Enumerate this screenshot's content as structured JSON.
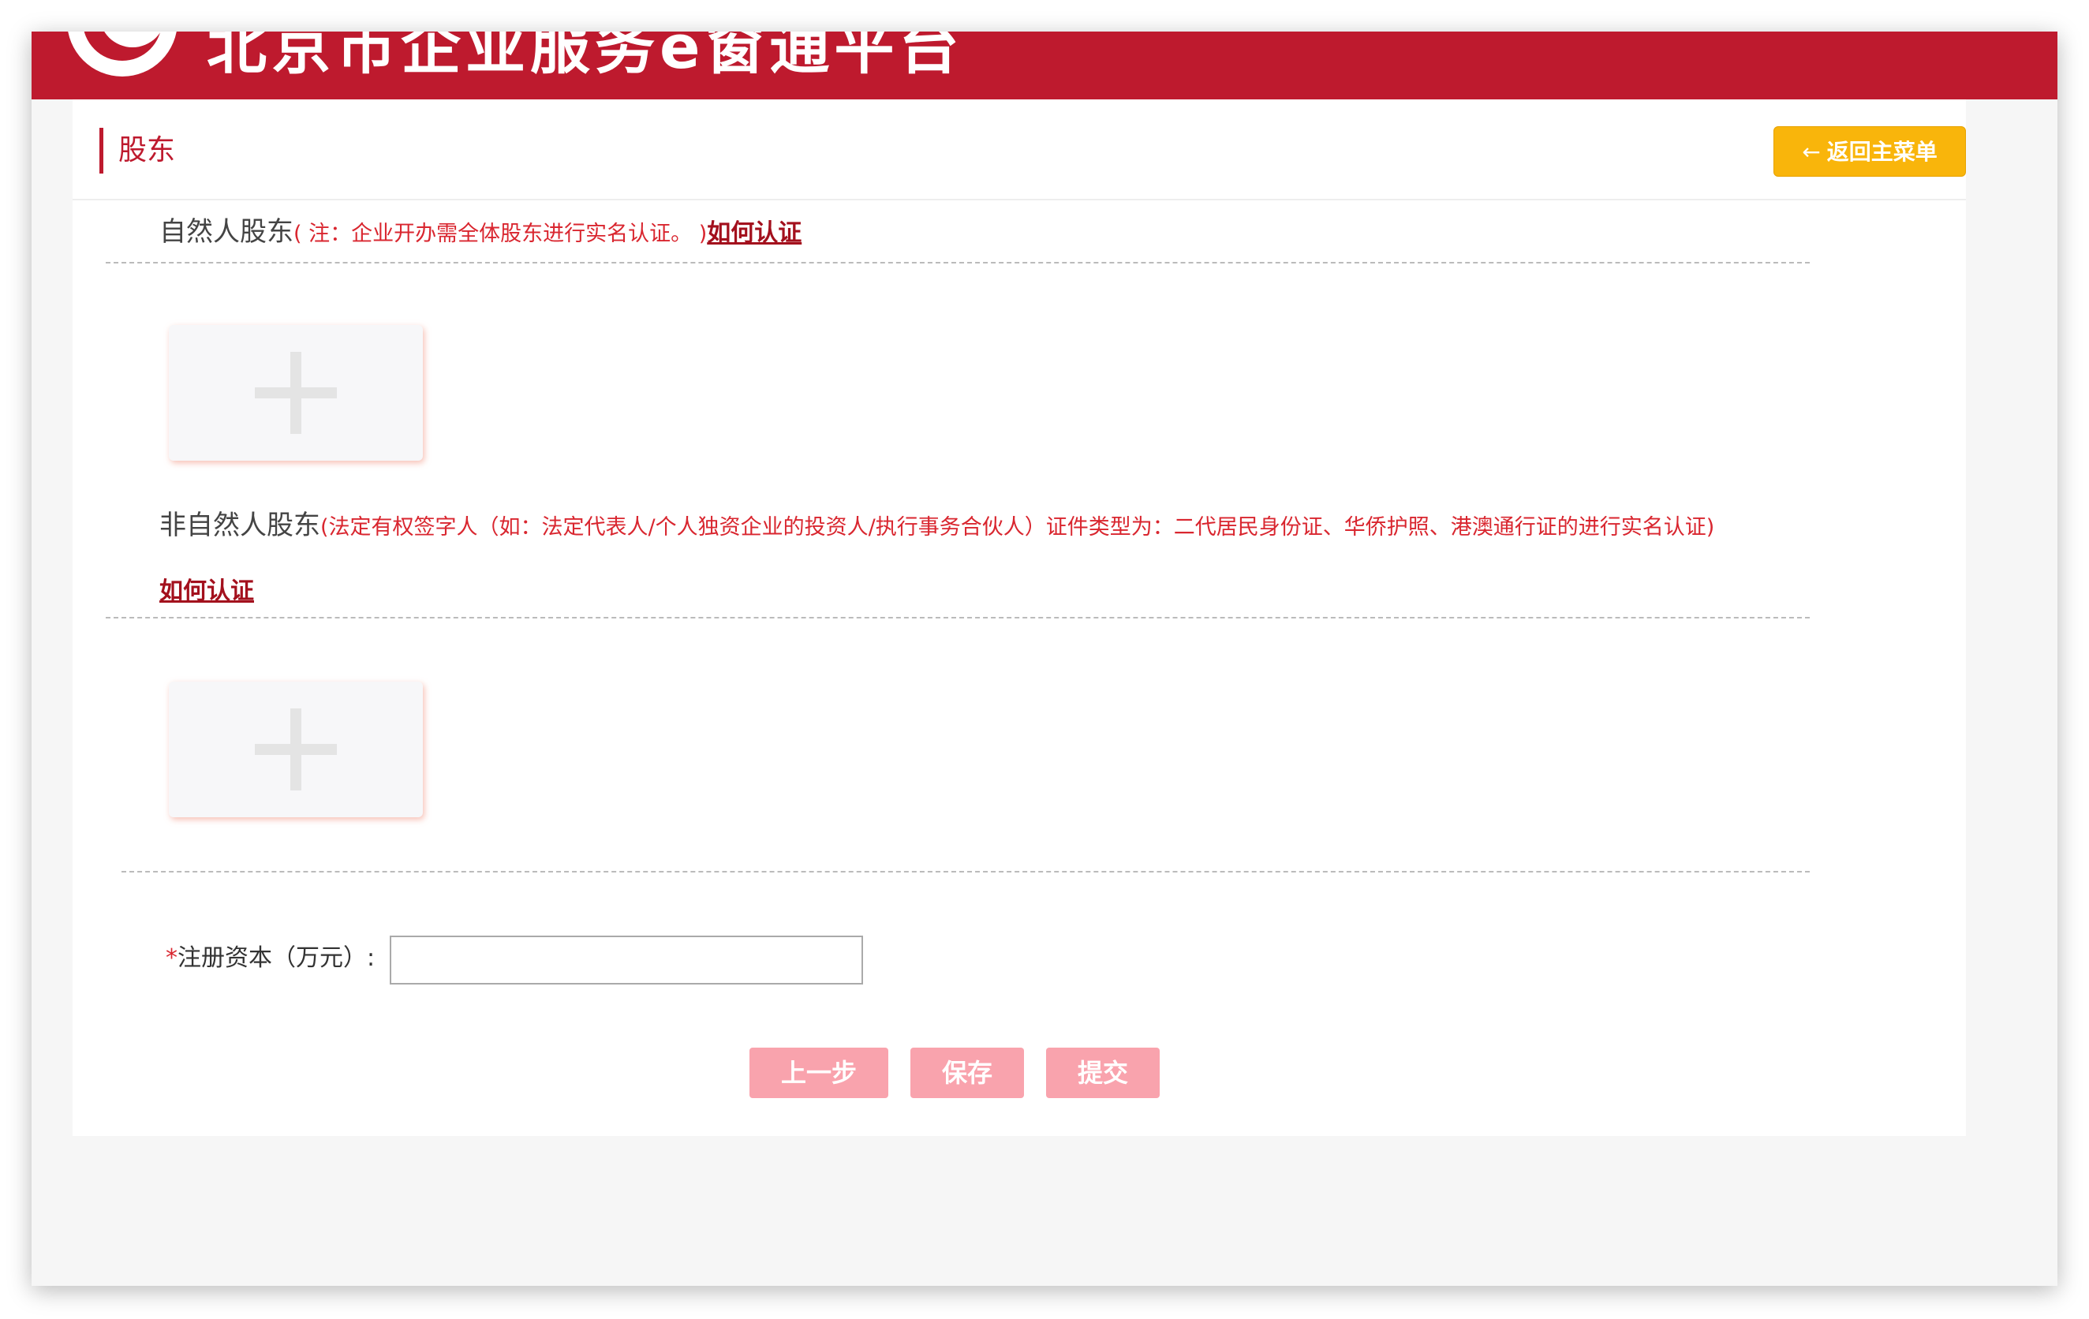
{
  "header": {
    "site_title": "北京市企业服务e窗通平台"
  },
  "section": {
    "title": "股东",
    "back_button_label": "返回主菜单"
  },
  "natural_shareholders": {
    "title": "自然人股东",
    "note": "( 注：企业开办需全体股东进行实名认证。 )",
    "howto_link": "如何认证"
  },
  "non_natural_shareholders": {
    "title": "非自然人股东",
    "note": "(法定有权签字人（如：法定代表人/个人独资企业的投资人/执行事务合伙人）证件类型为：二代居民身份证、华侨护照、港澳通行证的进行实名认证)",
    "howto_link": "如何认证"
  },
  "registered_capital": {
    "required_mark": "*",
    "label": "注册资本（万元）:",
    "value": ""
  },
  "actions": {
    "prev_label": "上一步",
    "save_label": "保存",
    "submit_label": "提交"
  },
  "colors": {
    "brand_red": "#be1a2e",
    "back_button": "#f9b50b",
    "action_button": "#f9a3ad",
    "note_red": "#d9262f"
  }
}
